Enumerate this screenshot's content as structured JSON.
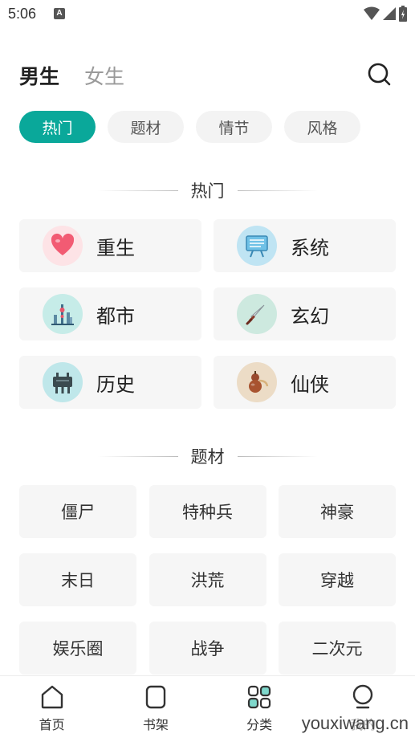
{
  "status_bar": {
    "time": "5:06",
    "notif_badge": "A"
  },
  "header": {
    "tabs": [
      {
        "label": "男生"
      },
      {
        "label": "女生"
      }
    ]
  },
  "pills": [
    {
      "label": "热门"
    },
    {
      "label": "题材"
    },
    {
      "label": "情节"
    },
    {
      "label": "风格"
    }
  ],
  "sections": {
    "hot_title": "热门",
    "topic_title": "题材"
  },
  "hot_items": [
    {
      "label": "重生",
      "icon": "heart-icon"
    },
    {
      "label": "系统",
      "icon": "screen-icon"
    },
    {
      "label": "都市",
      "icon": "city-tower-icon"
    },
    {
      "label": "玄幻",
      "icon": "sword-icon"
    },
    {
      "label": "历史",
      "icon": "bronze-ding-icon"
    },
    {
      "label": "仙侠",
      "icon": "gourd-icon"
    }
  ],
  "topics": [
    {
      "label": "僵尸"
    },
    {
      "label": "特种兵"
    },
    {
      "label": "神豪"
    },
    {
      "label": "末日"
    },
    {
      "label": "洪荒"
    },
    {
      "label": "穿越"
    },
    {
      "label": "娱乐圈"
    },
    {
      "label": "战争"
    },
    {
      "label": "二次元"
    }
  ],
  "bottom_nav": [
    {
      "label": "首页",
      "icon": "home-icon"
    },
    {
      "label": "书架",
      "icon": "bookshelf-icon"
    },
    {
      "label": "分类",
      "icon": "category-grid-icon"
    },
    {
      "label": "我的",
      "icon": "profile-icon"
    }
  ],
  "watermark": "youxiwang.cn",
  "colors": {
    "accent": "#0aa89a",
    "card_bg": "#f6f6f6",
    "pill_bg": "#f3f3f3"
  }
}
